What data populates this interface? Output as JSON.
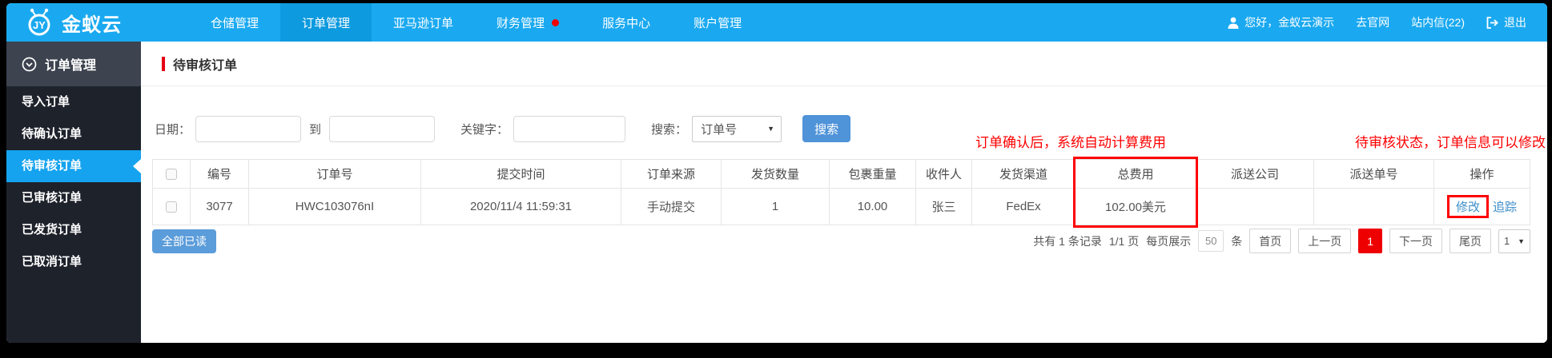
{
  "nav": {
    "logo_text": "金蚁云",
    "logo_monogram": "JY",
    "items": [
      {
        "label": "仓储管理"
      },
      {
        "label": "订单管理"
      },
      {
        "label": "亚马逊订单"
      },
      {
        "label": "财务管理"
      },
      {
        "label": "服务中心"
      },
      {
        "label": "账户管理"
      }
    ],
    "user_greeting": "您好，金蚁云演示",
    "official_site": "去官网",
    "messages": "站内信(22)",
    "logout": "退出"
  },
  "sidebar": {
    "header": "订单管理",
    "items": [
      {
        "label": "导入订单"
      },
      {
        "label": "待确认订单"
      },
      {
        "label": "待审核订单"
      },
      {
        "label": "已审核订单"
      },
      {
        "label": "已发货订单"
      },
      {
        "label": "已取消订单"
      }
    ]
  },
  "page": {
    "title": "待审核订单"
  },
  "filters": {
    "date_label": "日期：",
    "to_label": "到",
    "keyword_label": "关键字：",
    "search_label": "搜索：",
    "search_type_selected": "订单号",
    "search_button": "搜索",
    "dropdown_arrow": "▼"
  },
  "annotations": {
    "fee_note": "订单确认后，系统自动计算费用",
    "status_note": "待审核状态，订单信息可以修改"
  },
  "table": {
    "headers": [
      "编号",
      "订单号",
      "提交时间",
      "订单来源",
      "发货数量",
      "包裹重量",
      "收件人",
      "发货渠道",
      "总费用",
      "派送公司",
      "派送单号",
      "操作"
    ],
    "rows": [
      {
        "id": "3077",
        "order_no": "HWC103076nI",
        "submit_time": "2020/11/4 11:59:31",
        "source": "手动提交",
        "qty": "1",
        "weight": "10.00",
        "recipient": "张三",
        "channel": "FedEx",
        "total_fee": "102.00美元",
        "delivery_company": "",
        "tracking_no": "",
        "actions": [
          "修改",
          "追踪"
        ]
      }
    ]
  },
  "footer": {
    "mark_all_read": "全部已读",
    "record_summary": "共有 1 条记录",
    "page_summary": "1/1 页",
    "per_page_label": "每页展示",
    "per_page_value": "50",
    "per_page_unit": "条",
    "first_page": "首页",
    "prev_page": "上一页",
    "current_page": "1",
    "next_page": "下一页",
    "last_page": "尾页",
    "page_select_value": "1",
    "dropdown_arrow": "▼"
  },
  "colors": {
    "nav_blue": "#1aa9f0",
    "nav_active_blue": "#0d9adf",
    "sidebar_dark": "#1e222b",
    "sidebar_header": "#3d434f",
    "active_item_blue": "#15a3ef",
    "annotation_red": "#fe0000",
    "title_accent_red": "#e60012",
    "button_blue": "#4f93d8",
    "link_blue": "#3d8fc9",
    "current_page_red": "#ee0000"
  }
}
